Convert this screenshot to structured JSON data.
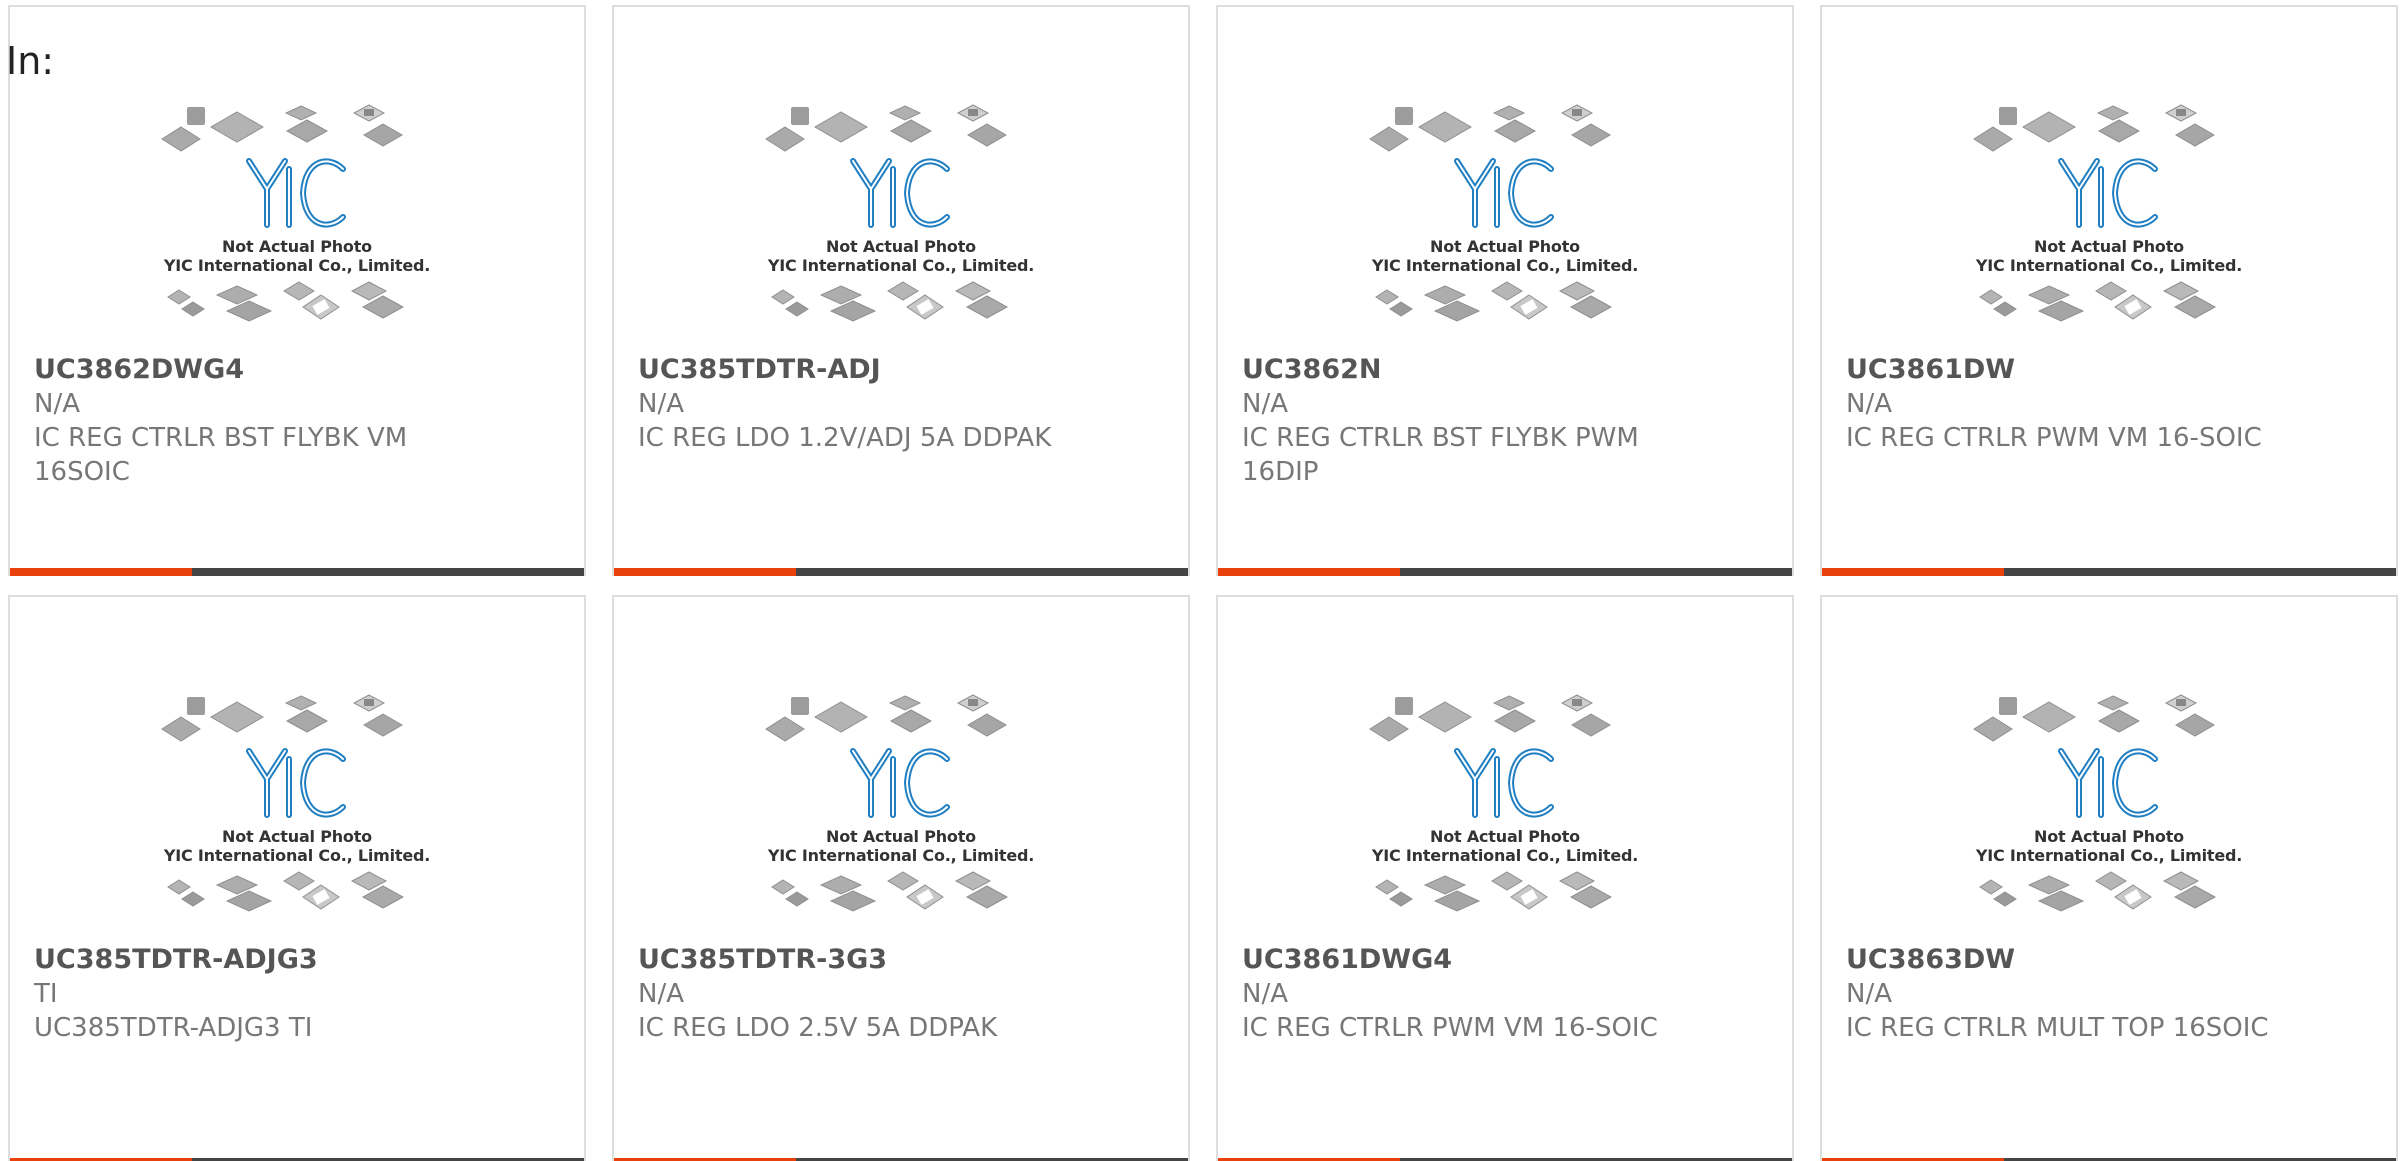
{
  "heading": {
    "label": "In:"
  },
  "colors": {
    "accent": "#e8420a",
    "bar": "#444444"
  },
  "placeholder_image": {
    "logo": "YIC",
    "caption_line1": "Not Actual Photo",
    "caption_line2": "YIC International Co., Limited."
  },
  "products": [
    {
      "part_number": "UC3862DWG4",
      "manufacturer": "N/A",
      "description": "IC REG CTRLR BST FLYBK VM 16SOIC"
    },
    {
      "part_number": "UC385TDTR-ADJ",
      "manufacturer": "N/A",
      "description": "IC REG LDO 1.2V/ADJ 5A DDPAK"
    },
    {
      "part_number": "UC3862N",
      "manufacturer": "N/A",
      "description": "IC REG CTRLR BST FLYBK PWM 16DIP"
    },
    {
      "part_number": "UC3861DW",
      "manufacturer": "N/A",
      "description": "IC REG CTRLR PWM VM 16-SOIC"
    },
    {
      "part_number": "UC385TDTR-ADJG3",
      "manufacturer": "TI",
      "description": "UC385TDTR-ADJG3 TI"
    },
    {
      "part_number": "UC385TDTR-3G3",
      "manufacturer": "N/A",
      "description": "IC REG LDO 2.5V 5A DDPAK"
    },
    {
      "part_number": "UC3861DWG4",
      "manufacturer": "N/A",
      "description": "IC REG CTRLR PWM VM 16-SOIC"
    },
    {
      "part_number": "UC3863DW",
      "manufacturer": "N/A",
      "description": "IC REG CTRLR MULT TOP 16SOIC"
    }
  ]
}
